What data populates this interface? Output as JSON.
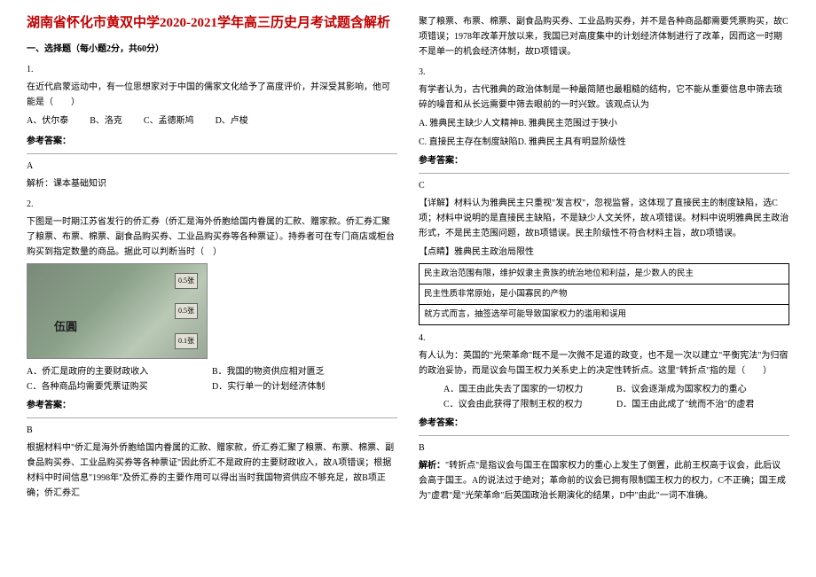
{
  "title": "湖南省怀化市黄双中学2020-2021学年高三历史月考试题含解析",
  "section1": "一、选择题（每小题2分，共60分）",
  "q1": {
    "num": "1.",
    "text": "在近代启蒙运动中，有一位思想家对于中国的儒家文化给予了高度评价，并深受其影响，他可能是（　　）",
    "opts": {
      "a": "A、伏尔泰",
      "b": "B、洛克",
      "c": "C、孟德斯鸠",
      "d": "D、卢梭"
    },
    "ansLabel": "参考答案：",
    "ans": "A",
    "expLabel": "解析：课本基础知识"
  },
  "q2": {
    "num": "2.",
    "text": "下图是一时期江苏省发行的侨汇券（侨汇是海外侨胞给国内眷属的汇款、赠家款。侨汇券汇聚了粮票、布票、棉票、副食品购买券、工业品购买券等各种票证）。持券者可在专门商店或柜台购买到指定数量的商品。据此可以判断当时（　）",
    "img": {
      "wuyuan": "伍圓",
      "t1": "0.5张",
      "t2": "0.5张",
      "t3": "0.1张"
    },
    "opts": {
      "a": "A．侨汇是政府的主要财政收入",
      "b": "B．我国的物资供应相对匮乏",
      "c": "C．各种商品均需要凭票证购买",
      "d": "D．实行单一的计划经济体制"
    },
    "ansLabel": "参考答案：",
    "ans": "B",
    "exp": "根据材料中\"侨汇是海外侨胞给国内眷属的汇款、赠家款，侨汇券汇聚了粮票、布票、棉票、副食品购买券、工业品购买券等各种票证\"因此侨汇不是政府的主要财政收入，故A项错误；根据材料中时间信息\"1998年\"及侨汇券的主要作用可以得出当时我国物资供应不够充足，故B项正确；侨汇券汇"
  },
  "right_top": "聚了粮票、布票、棉票、副食品购买券、工业品购买券，并不是各种商品都需要凭票购买，故C项错误；1978年改革开放以来，我国已对高度集中的计划经济体制进行了改革，因而这一时期不是单一的机会经济体制，故D项错误。",
  "q3": {
    "num": "3.",
    "text1": "有学者认为，古代雅典的政治体制是一种最简陋也最粗糙的结构，它不能从重要信息中筛去琐碎的噪音和从长远需要中筛去眼前的一时兴致。该观点认为",
    "optA": "A. 雅典民主缺少人文精神B. 雅典民主范围过于狭小",
    "optC": "C. 直接民主存在制度缺陷D. 雅典民主具有明显阶级性",
    "ansLabel": "参考答案：",
    "ans": "C",
    "exp1": "【详解】材料认为雅典民主只重视\"发言权\"，忽视监督，这体现了直接民主的制度缺陷，选C项；材料中说明的是直接民主缺陷，不是缺少人文关怀，故A项错误。材料中说明雅典民主政治形式，不是民主范围问题，故B项错误。民主阶级性不符合材料主旨，故D项错误。",
    "exp2": "【点睛】雅典民主政治局限性",
    "table": {
      "r1": "民主政治范围有限，维护奴隶主贵族的统治地位和利益，是少数人的民主",
      "r2": "民主性质非常原始，是小国寡民的产物",
      "r3": "就方式而言，抽签选举可能导致国家权力的滥用和误用"
    }
  },
  "q4": {
    "num": "4.",
    "text": "有人认为：英国的\"光荣革命\"既不是一次微不足道的政变，也不是一次以建立\"平衡宪法\"为归宿的政治妥协，而是议会与国王权力关系史上的决定性转折点。这里\"转折点\"指的是（　　）",
    "opts": {
      "a": "A．国王由此失去了国家的一切权力",
      "b": "B．议会逐渐成为国家权力的重心",
      "c": "C．议会由此获得了限制王权的权力",
      "d": "D．国王由此成了\"统而不治\"的虚君"
    },
    "ansLabel": "参考答案：",
    "ans": "B",
    "expLabel": "解析：",
    "exp": "\"转折点\"是指议会与国王在国家权力的重心上发生了倒置，此前王权高于议会，此后议会高于国王。A的说法过于绝对；革命前的议会已拥有限制国王权力的权力，C不正确；国王成为\"虚君\"是\"光荣革命\"后英国政治长期演化的结果，D中\"由此\"一词不准确。"
  }
}
